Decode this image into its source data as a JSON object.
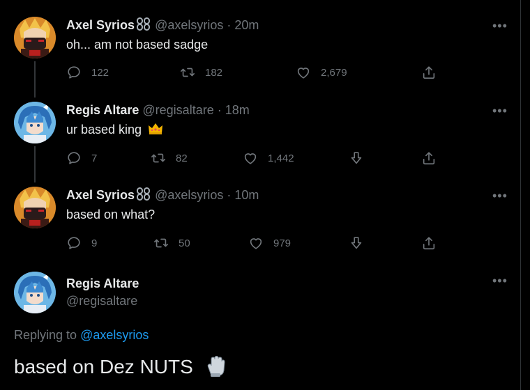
{
  "tweets": [
    {
      "name": "Axel Syrios",
      "handle": "@axelsyrios",
      "sep": "·",
      "time": "20m",
      "text": "oh... am not based sadge",
      "replies": "122",
      "retweets": "182",
      "likes": "2,679"
    },
    {
      "name": "Regis Altare",
      "handle": "@regisaltare",
      "sep": "·",
      "time": "18m",
      "text": "ur based king",
      "replies": "7",
      "retweets": "82",
      "likes": "1,442"
    },
    {
      "name": "Axel Syrios",
      "handle": "@axelsyrios",
      "sep": "·",
      "time": "10m",
      "text": "based on what?",
      "replies": "9",
      "retweets": "50",
      "likes": "979"
    }
  ],
  "main_tweet": {
    "name": "Regis Altare",
    "handle": "@regisaltare",
    "replying_label": "Replying to",
    "replying_handle": "@axelsyrios",
    "text": "based on Dez NUTS"
  },
  "more_label": "•••",
  "colors": {
    "background": "#000000",
    "text": "#e7e9ea",
    "muted": "#71767b",
    "link": "#1d9bf0"
  },
  "icons": [
    "reply-icon",
    "retweet-icon",
    "like-icon",
    "share-icon",
    "downvote-icon",
    "more-icon",
    "crown-emoji",
    "glove-emoji",
    "chain-emoji"
  ]
}
